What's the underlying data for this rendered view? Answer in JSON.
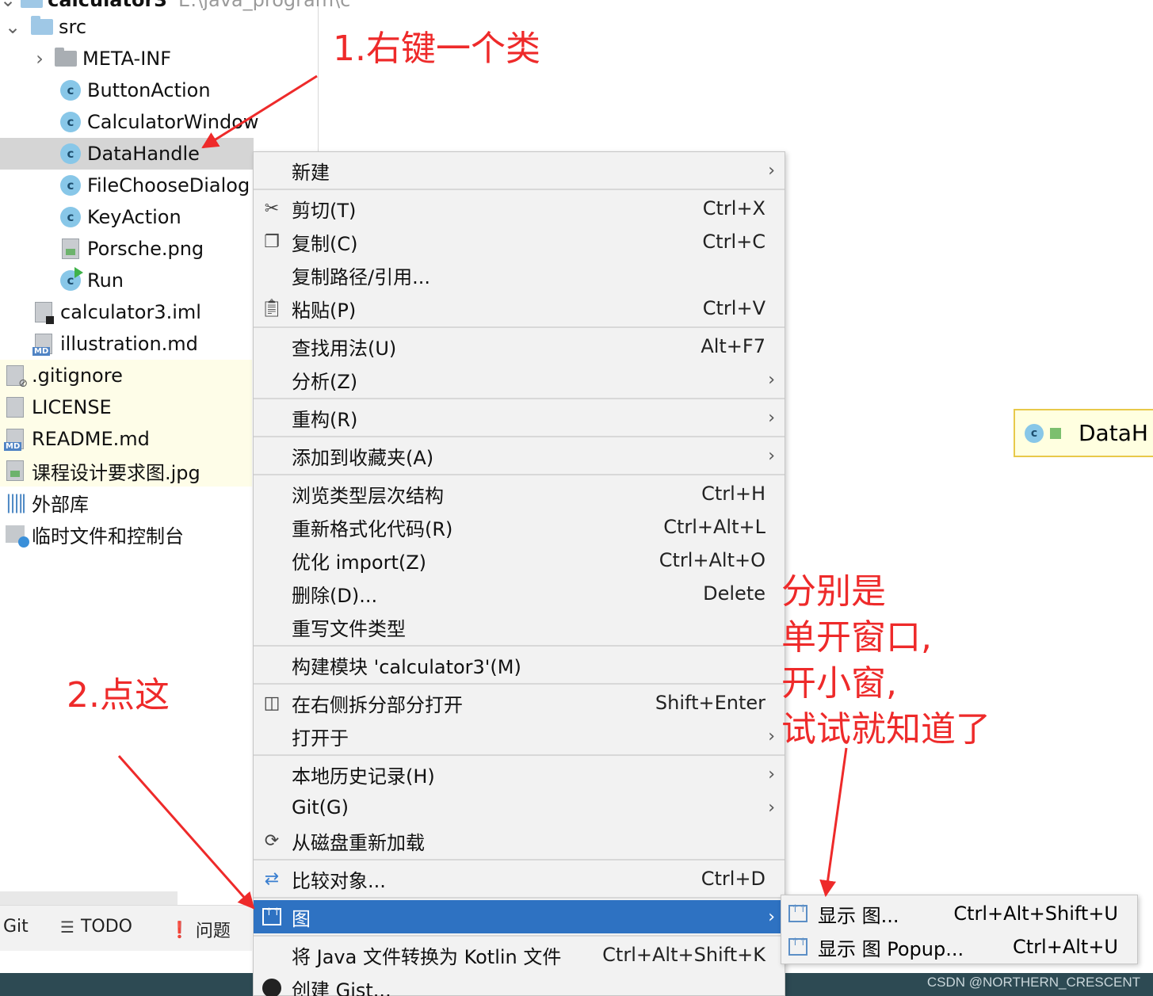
{
  "tree": {
    "root_label": "calculator3",
    "root_path": "E:\\java_program\\c",
    "items": [
      {
        "label": "src",
        "icon": "folder-icon"
      },
      {
        "label": "META-INF",
        "icon": "folder-icon"
      },
      {
        "label": "ButtonAction",
        "icon": "java-class-icon"
      },
      {
        "label": "CalculatorWindow",
        "icon": "java-class-icon"
      },
      {
        "label": "DataHandle",
        "icon": "java-class-icon"
      },
      {
        "label": "FileChooseDialog",
        "icon": "java-class-icon"
      },
      {
        "label": "KeyAction",
        "icon": "java-class-icon"
      },
      {
        "label": "Porsche.png",
        "icon": "image-file-icon"
      },
      {
        "label": "Run",
        "icon": "run-class-icon"
      },
      {
        "label": "calculator3.iml",
        "icon": "iml-file-icon"
      },
      {
        "label": "illustration.md",
        "icon": "markdown-file-icon"
      },
      {
        "label": ".gitignore",
        "icon": "gitignore-file-icon"
      },
      {
        "label": "LICENSE",
        "icon": "text-file-icon"
      },
      {
        "label": "README.md",
        "icon": "markdown-file-icon"
      },
      {
        "label": "课程设计要求图.jpg",
        "icon": "image-file-icon"
      },
      {
        "label": "外部库",
        "icon": "library-icon"
      },
      {
        "label": "临时文件和控制台",
        "icon": "scratch-icon"
      }
    ],
    "class_letter": "c"
  },
  "toolbar": {
    "git": "Git",
    "todo": "TODO",
    "problems": "问题"
  },
  "editor_tab": {
    "label": "DataH"
  },
  "menu": {
    "new": {
      "label": "新建"
    },
    "cut": {
      "label": "剪切(T)",
      "shortcut": "Ctrl+X"
    },
    "copy": {
      "label": "复制(C)",
      "shortcut": "Ctrl+C"
    },
    "copy_path": {
      "label": "复制路径/引用..."
    },
    "paste": {
      "label": "粘贴(P)",
      "shortcut": "Ctrl+V"
    },
    "find_usages": {
      "label": "查找用法(U)",
      "shortcut": "Alt+F7"
    },
    "analyze": {
      "label": "分析(Z)"
    },
    "refactor": {
      "label": "重构(R)"
    },
    "add_favorites": {
      "label": "添加到收藏夹(A)"
    },
    "type_hierarchy": {
      "label": "浏览类型层次结构",
      "shortcut": "Ctrl+H"
    },
    "reformat": {
      "label": "重新格式化代码(R)",
      "shortcut": "Ctrl+Alt+L"
    },
    "optimize_imports": {
      "label": "优化 import(Z)",
      "shortcut": "Ctrl+Alt+O"
    },
    "delete": {
      "label": "删除(D)...",
      "shortcut": "Delete"
    },
    "override_file_type": {
      "label": "重写文件类型"
    },
    "build_module": {
      "label": "构建模块 'calculator3'(M)"
    },
    "open_split": {
      "label": "在右侧拆分部分打开",
      "shortcut": "Shift+Enter"
    },
    "open_in": {
      "label": "打开于"
    },
    "local_history": {
      "label": "本地历史记录(H)"
    },
    "git": {
      "label": "Git(G)"
    },
    "reload": {
      "label": "从磁盘重新加载"
    },
    "compare": {
      "label": "比较对象...",
      "shortcut": "Ctrl+D"
    },
    "diagrams": {
      "label": "图"
    },
    "convert_kotlin": {
      "label": "将 Java 文件转换为 Kotlin 文件",
      "shortcut": "Ctrl+Alt+Shift+K"
    },
    "create_gist": {
      "label": "创建 Gist..."
    }
  },
  "submenu": {
    "show_diagram": {
      "label": "显示 图...",
      "shortcut": "Ctrl+Alt+Shift+U"
    },
    "show_diagram_popup": {
      "label": "显示 图 Popup...",
      "shortcut": "Ctrl+Alt+U"
    }
  },
  "annotations": {
    "step1": "1.右键一个类",
    "step2": "2.点这",
    "note": [
      "分别是",
      "单开窗口,",
      "开小窗,",
      "试试就知道了"
    ]
  },
  "watermark": "CSDN @NORTHERN_CRESCENT",
  "colors": {
    "highlight": "#2e72c2",
    "annotation": "#ee2a2a",
    "selected_row": "#d5d5d5",
    "ignored_files_bg": "#fefde8"
  }
}
